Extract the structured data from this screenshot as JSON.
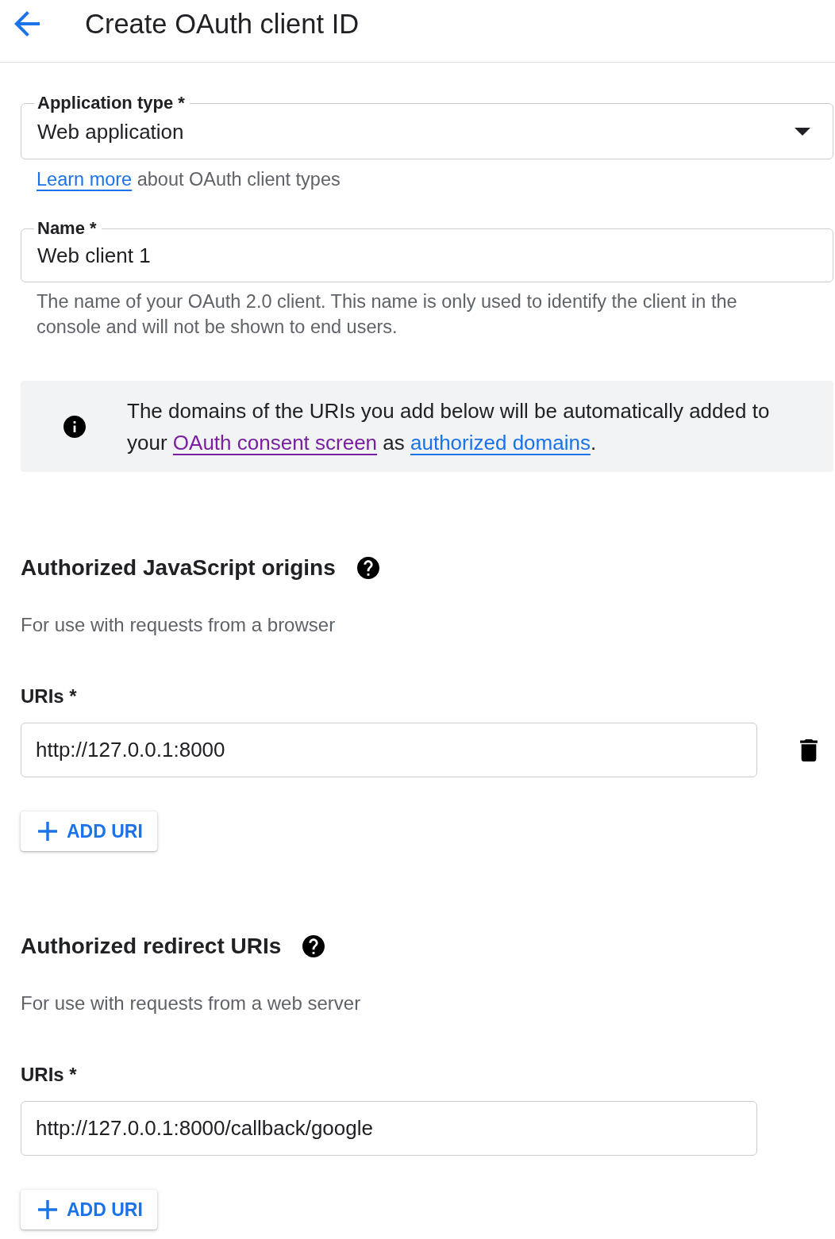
{
  "header": {
    "title": "Create OAuth client ID"
  },
  "application_type": {
    "label": "Application type *",
    "value": "Web application",
    "helper": [
      {
        "kind": "link",
        "text": "Learn more",
        "visited": false
      },
      {
        "kind": "text",
        "text": " about OAuth client types"
      }
    ]
  },
  "name": {
    "label": "Name *",
    "value": "Web client 1",
    "helper": "The name of your OAuth 2.0 client. This name is only used to identify the client in the console and will not be shown to end users."
  },
  "info_banner": {
    "segments": [
      {
        "kind": "text",
        "text": "The domains of the URIs you add below will be automatically added to your "
      },
      {
        "kind": "link",
        "text": "OAuth consent screen",
        "visited": true
      },
      {
        "kind": "text",
        "text": " as "
      },
      {
        "kind": "link",
        "text": "authorized domains",
        "visited": false
      },
      {
        "kind": "text",
        "text": "."
      }
    ]
  },
  "sections": [
    {
      "title": "Authorized JavaScript origins",
      "subtitle": "For use with requests from a browser",
      "uris_label": "URIs *",
      "uris": [
        {
          "value": "http://127.0.0.1:8000",
          "deletable": true
        }
      ],
      "add_button": "ADD URI"
    },
    {
      "title": "Authorized redirect URIs",
      "subtitle": "For use with requests from a web server",
      "uris_label": "URIs *",
      "uris": [
        {
          "value": "http://127.0.0.1:8000/callback/google",
          "deletable": false
        }
      ],
      "add_button": "ADD URI"
    }
  ]
}
